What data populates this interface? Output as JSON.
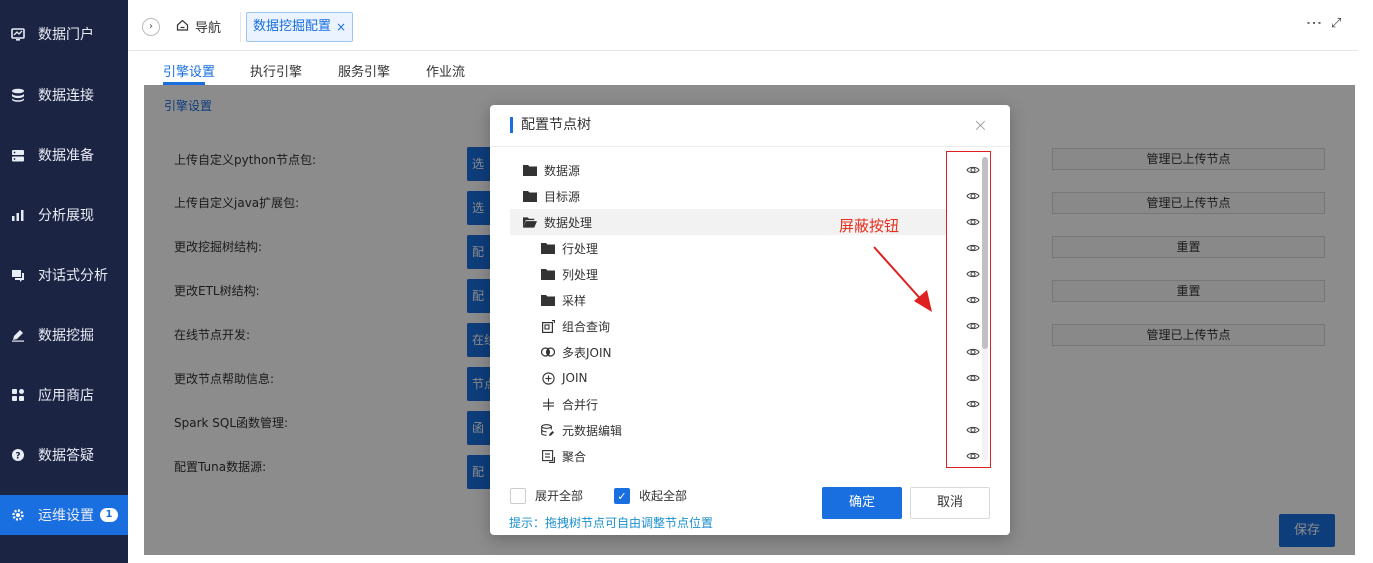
{
  "sidebar": {
    "items": [
      {
        "label": "数据门户",
        "icon": "monitor-chart-icon"
      },
      {
        "label": "数据连接",
        "icon": "database-icon"
      },
      {
        "label": "数据准备",
        "icon": "server-icon"
      },
      {
        "label": "分析展现",
        "icon": "bar-chart-icon"
      },
      {
        "label": "对话式分析",
        "icon": "chat-icon"
      },
      {
        "label": "数据挖掘",
        "icon": "pen-icon"
      },
      {
        "label": "应用商店",
        "icon": "grid-icon"
      },
      {
        "label": "数据答疑",
        "icon": "help-icon"
      },
      {
        "label": "运维设置",
        "icon": "gear-icon",
        "badge": "1",
        "active": true
      }
    ]
  },
  "topbar": {
    "home_label": "导航",
    "open_tab": "数据挖掘配置",
    "close_glyph": "×",
    "collapse_glyph": "›",
    "more_glyph": "⋮",
    "expand_glyph": "⤢"
  },
  "tabs": [
    {
      "label": "引擎设置",
      "active": true
    },
    {
      "label": "执行引擎"
    },
    {
      "label": "服务引擎"
    },
    {
      "label": "作业流"
    }
  ],
  "settings": {
    "section_title": "引擎设置",
    "rows": [
      {
        "label": "上传自定义python节点包:",
        "button": "选",
        "right_button": "管理已上传节点"
      },
      {
        "label": "上传自定义java扩展包:",
        "button": "选",
        "right_button": "管理已上传节点"
      },
      {
        "label": "更改挖掘树结构:",
        "button": "配",
        "right_button": "重置"
      },
      {
        "label": "更改ETL树结构:",
        "button": "配",
        "right_button": "重置"
      },
      {
        "label": "在线节点开发:",
        "button": "在线",
        "right_button": "管理已上传节点"
      },
      {
        "label": "更改节点帮助信息:",
        "button": "节点",
        "right_button": ""
      },
      {
        "label": "Spark SQL函数管理:",
        "button": "函",
        "right_button": ""
      },
      {
        "label": "配置Tuna数据源:",
        "button": "配",
        "right_button": ""
      }
    ],
    "save_label": "保存"
  },
  "modal": {
    "title": "配置节点树",
    "close_glyph": "×",
    "annotation": "屏蔽按钮",
    "nodes": [
      {
        "label": "数据源",
        "icon": "folder-icon",
        "level": 0
      },
      {
        "label": "目标源",
        "icon": "folder-icon",
        "level": 0
      },
      {
        "label": "数据处理",
        "icon": "folder-open-icon",
        "level": 0,
        "highlighted": true
      },
      {
        "label": "行处理",
        "icon": "folder-icon",
        "level": 1
      },
      {
        "label": "列处理",
        "icon": "folder-icon",
        "level": 1
      },
      {
        "label": "采样",
        "icon": "folder-icon",
        "level": 1
      },
      {
        "label": "组合查询",
        "icon": "combine-query-icon",
        "level": 1
      },
      {
        "label": "多表JOIN",
        "icon": "multi-join-icon",
        "level": 1
      },
      {
        "label": "JOIN",
        "icon": "join-icon",
        "level": 1
      },
      {
        "label": "合并行",
        "icon": "merge-rows-icon",
        "level": 1
      },
      {
        "label": "元数据编辑",
        "icon": "metadata-edit-icon",
        "level": 1
      },
      {
        "label": "聚合",
        "icon": "aggregate-icon",
        "level": 1
      }
    ],
    "expand_all_label": "展开全部",
    "expand_all_checked": false,
    "collapse_all_label": "收起全部",
    "collapse_all_checked": true,
    "hint": "提示：拖拽树节点可自由调整节点位置",
    "ok_label": "确定",
    "cancel_label": "取消"
  },
  "colors": {
    "sidebar_bg": "#1b2442",
    "accent": "#1a6fe0",
    "annotation": "#e02020"
  }
}
